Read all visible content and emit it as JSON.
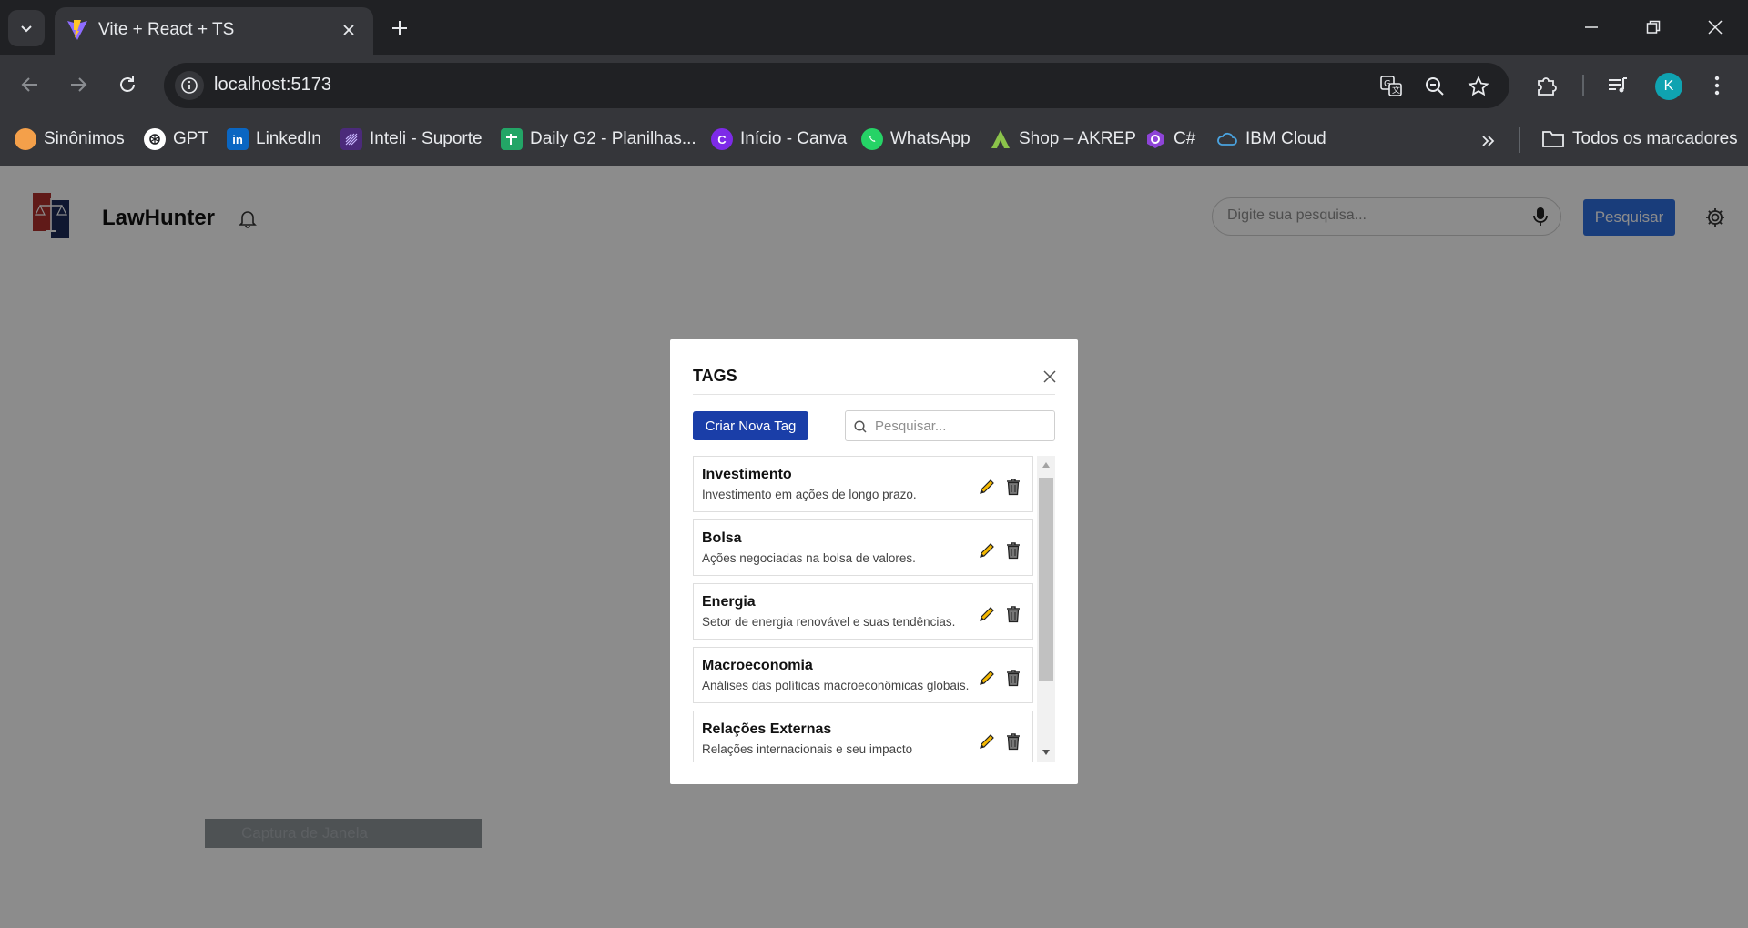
{
  "browser": {
    "tab_title": "Vite + React + TS",
    "url": "localhost:5173",
    "profile_initial": "K",
    "bookmarks": [
      {
        "label": "Sinônimos",
        "icon": "sinonimos-icon",
        "color": "#f4a04a"
      },
      {
        "label": "GPT",
        "icon": "openai-icon",
        "color": "#ffffff"
      },
      {
        "label": "LinkedIn",
        "icon": "linkedin-icon",
        "color": "#0a66c2"
      },
      {
        "label": "Inteli - Suporte",
        "icon": "inteli-icon",
        "color": "#4b2a7a"
      },
      {
        "label": "Daily G2 - Planilhas...",
        "icon": "sheets-icon",
        "color": "#23a566"
      },
      {
        "label": "Início - Canva",
        "icon": "canva-icon",
        "color": "#7d2ae8"
      },
      {
        "label": "WhatsApp",
        "icon": "whatsapp-icon",
        "color": "#25d366"
      },
      {
        "label": "Shop – AKREP",
        "icon": "akrep-icon",
        "color": "#8bc34a"
      },
      {
        "label": "C#",
        "icon": "csharp-icon",
        "color": "#8e44d8"
      },
      {
        "label": "IBM Cloud",
        "icon": "ibm-cloud-icon",
        "color": "#4aa3df"
      }
    ],
    "all_bookmarks_label": "Todos os marcadores"
  },
  "app": {
    "title": "LawHunter",
    "search_placeholder": "Digite sua pesquisa...",
    "search_button": "Pesquisar",
    "capture_tip": "Captura de Janela"
  },
  "modal": {
    "title": "TAGS",
    "create_button": "Criar Nova Tag",
    "search_placeholder": "Pesquisar...",
    "tags": [
      {
        "name": "Investimento",
        "description": "Investimento em ações de longo prazo."
      },
      {
        "name": "Bolsa",
        "description": "Ações negociadas na bolsa de valores."
      },
      {
        "name": "Energia",
        "description": "Setor de energia renovável e suas tendências."
      },
      {
        "name": "Macroeconomia",
        "description": "Análises das políticas macroeconômicas globais."
      },
      {
        "name": "Relações Externas",
        "description": "Relações internacionais e seu impacto"
      }
    ]
  },
  "colors": {
    "primary_button": "#1a3ea8",
    "search_button": "#2f6fe0",
    "pencil": "#f5b800"
  }
}
